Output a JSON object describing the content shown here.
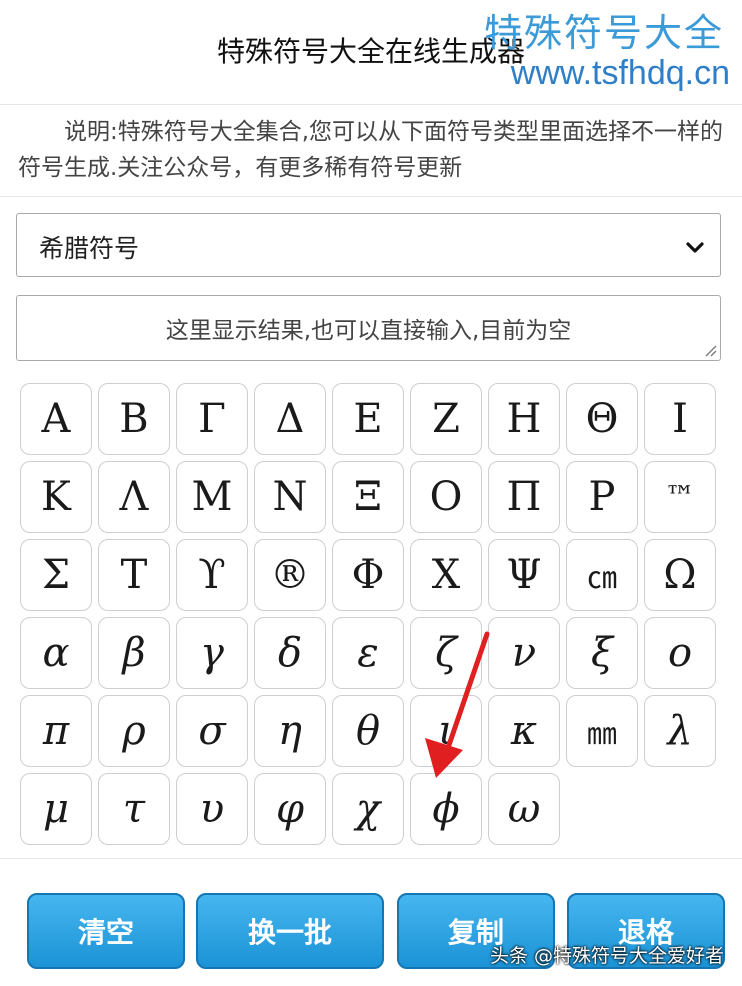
{
  "header": {
    "title": "特殊符号大全在线生成器",
    "watermark_cn": "特殊符号大全",
    "watermark_url": "www.tsfhdq.cn"
  },
  "description": "说明:特殊符号大全集合,您可以从下面符号类型里面选择不一样的符号生成.关注公众号，有更多稀有符号更新",
  "category_select": {
    "value": "希腊符号"
  },
  "result": {
    "placeholder": "这里显示结果,也可以直接输入,目前为空"
  },
  "symbols": [
    "Α",
    "Β",
    "Γ",
    "Δ",
    "Ε",
    "Ζ",
    "Η",
    "Θ",
    "Ι",
    "Κ",
    "Λ",
    "Μ",
    "Ν",
    "Ξ",
    "Ο",
    "Π",
    "Ρ",
    "™",
    "Σ",
    "Τ",
    "ϒ",
    "®",
    "Φ",
    "Χ",
    "Ψ",
    "㎝",
    "Ω",
    "α",
    "β",
    "γ",
    "δ",
    "ε",
    "ζ",
    "ν",
    "ξ",
    "ο",
    "π",
    "ρ",
    "σ",
    "η",
    "θ",
    "ι",
    "κ",
    "㎜",
    "λ",
    "μ",
    "τ",
    "υ",
    "φ",
    "χ",
    "ϕ",
    "ω"
  ],
  "buttons": {
    "clear": "清空",
    "refresh": "换一批",
    "copy": "复制",
    "backspace": "退格"
  },
  "credit": "头条 @特殊符号大全爱好者",
  "colors": {
    "button": "#1b93d6",
    "watermark": "#3b9ad8",
    "arrow": "#e02020"
  }
}
